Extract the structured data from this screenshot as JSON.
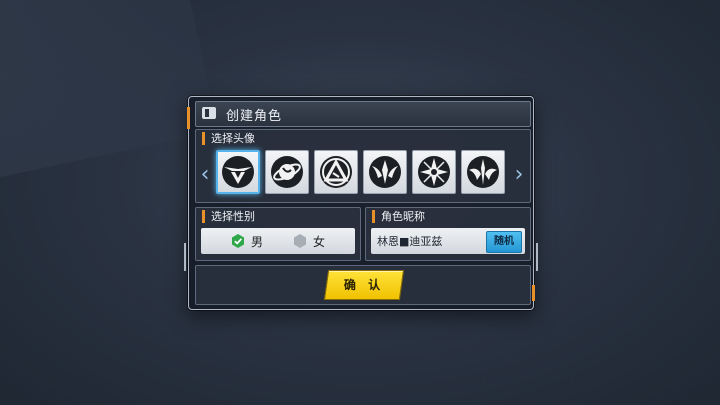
{
  "dialog": {
    "title": "创建角色"
  },
  "avatar_section": {
    "label": "选择头像",
    "avatars": [
      {
        "icon": "winged-v-emblem-icon",
        "selected": true
      },
      {
        "icon": "globe-ring-emblem-icon",
        "selected": false
      },
      {
        "icon": "triangle-circle-emblem-icon",
        "selected": false
      },
      {
        "icon": "horned-crest-emblem-icon",
        "selected": false
      },
      {
        "icon": "star-spike-emblem-icon",
        "selected": false
      },
      {
        "icon": "trident-wing-emblem-icon",
        "selected": false
      }
    ]
  },
  "gender_section": {
    "label": "选择性别",
    "male_label": "男",
    "female_label": "女",
    "selected": "male"
  },
  "nickname_section": {
    "label": "角色昵称",
    "value": "林恩■迪亚兹",
    "random_label": "随机"
  },
  "confirm": {
    "label": "确 认"
  },
  "colors": {
    "accent_orange": "#e8902a",
    "selected_blue": "#56b4ea",
    "confirm_yellow": "#f7d21a",
    "random_blue": "#2fa6e0",
    "check_green": "#2ea84a"
  }
}
